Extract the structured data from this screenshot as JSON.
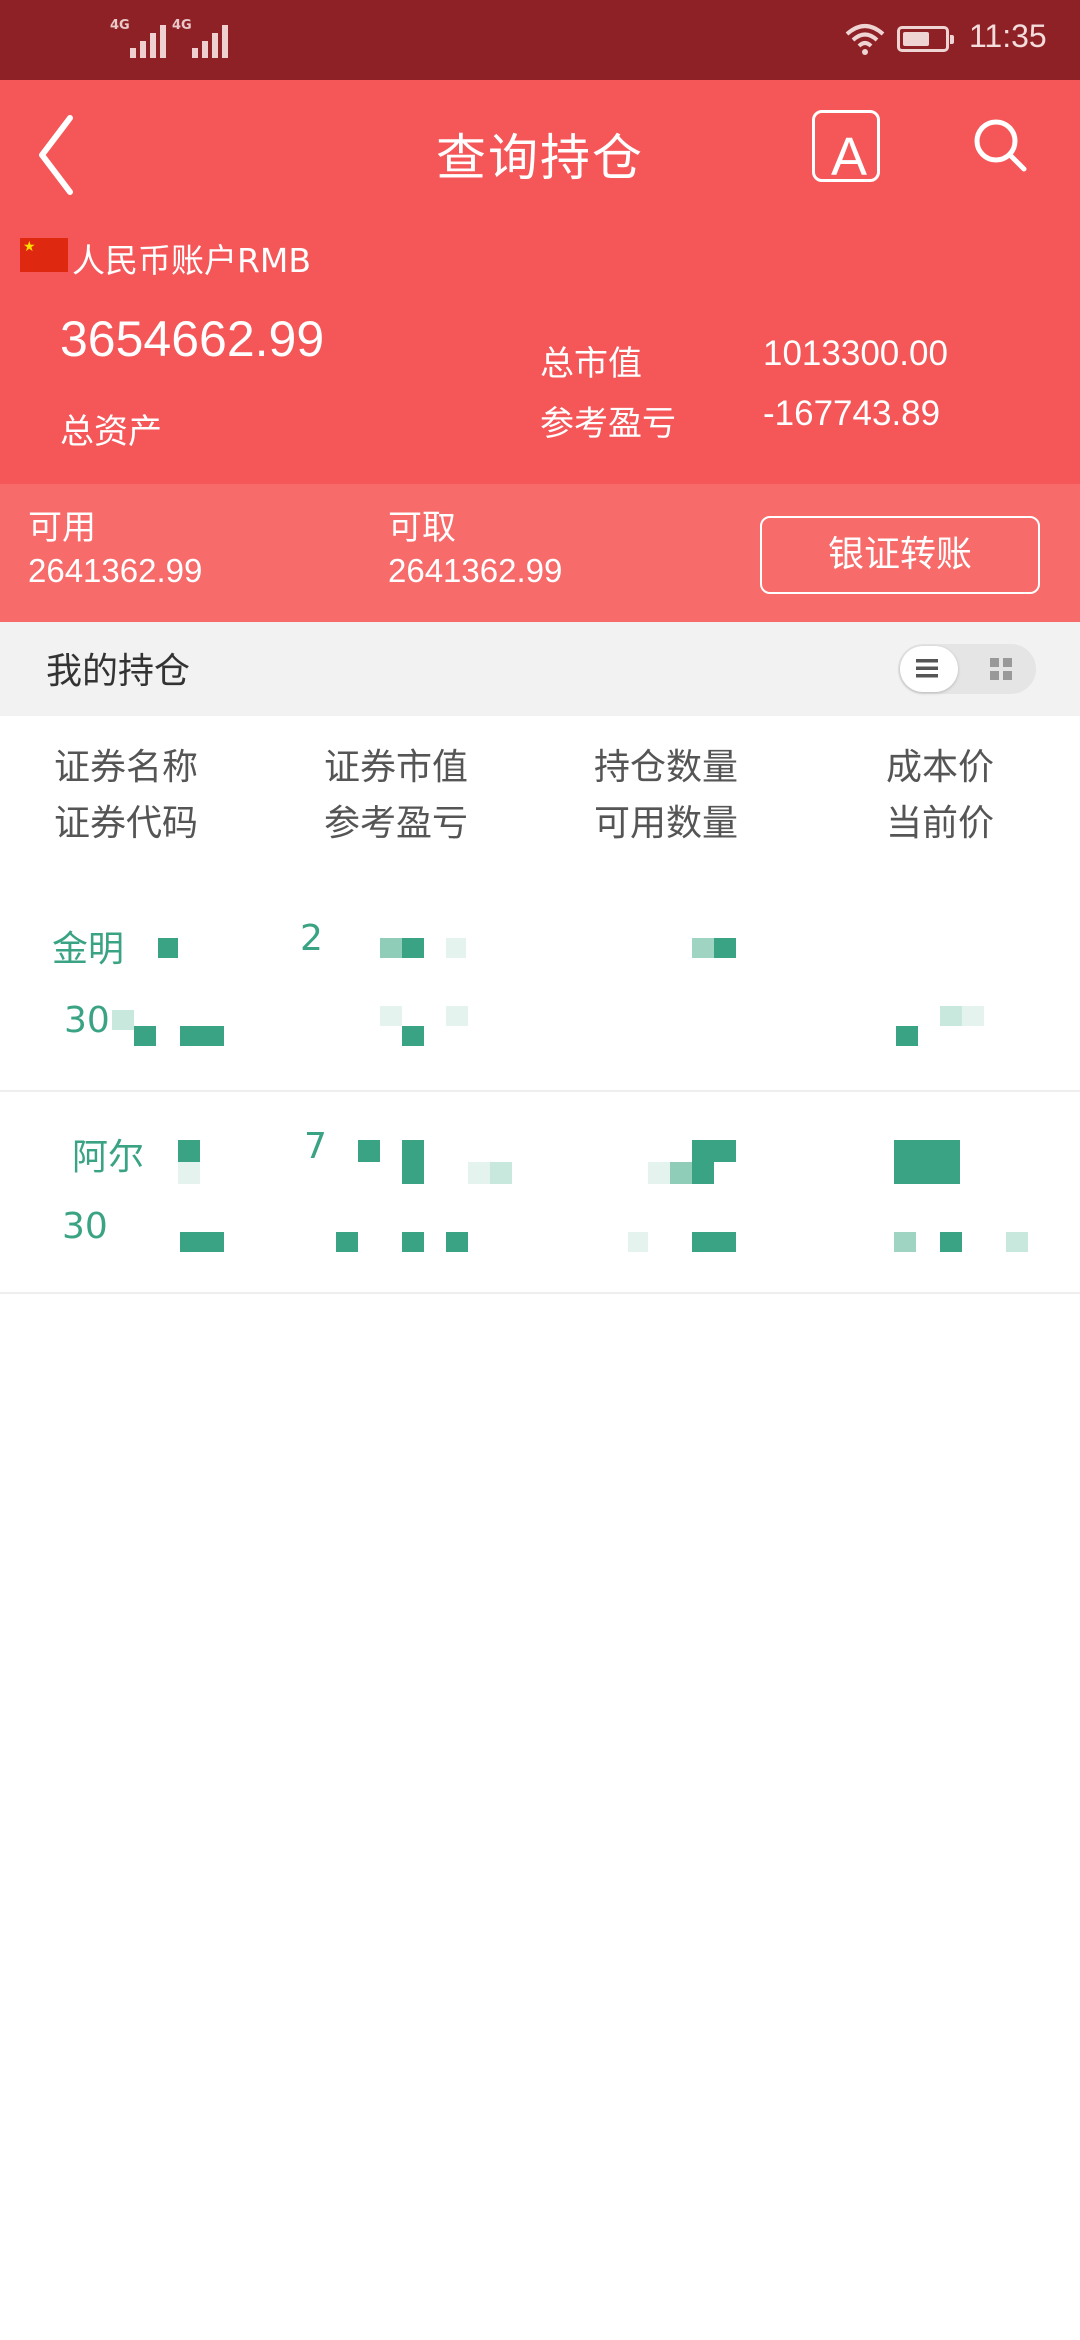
{
  "status_bar": {
    "signal_1_label": "4G",
    "signal_2_label": "4G",
    "time": "11:35",
    "battery_level": 0.65,
    "wifi_icon": "wifi-icon"
  },
  "header": {
    "title": "查询持仓",
    "font_button_label": "A",
    "back_icon": "back-chevron-icon",
    "search_icon": "search-icon"
  },
  "account": {
    "label": "人民币账户RMB",
    "flag_icon": "china-flag-icon",
    "total_assets_value": "3654662.99",
    "total_assets_label": "总资产",
    "market_value_label": "总市值",
    "market_value": "1013300.00",
    "pl_label": "参考盈亏",
    "pl_value": "-167743.89"
  },
  "funds": {
    "available_label": "可用",
    "available_value": "2641362.99",
    "withdrawable_label": "可取",
    "withdrawable_value": "2641362.99",
    "transfer_button": "银证转账"
  },
  "holdings": {
    "section_title": "我的持仓",
    "view_toggle": [
      "list-view-icon",
      "grid-view-icon"
    ],
    "columns": [
      {
        "line1": "证券名称",
        "line2": "证券代码"
      },
      {
        "line1": "证券市值",
        "line2": "参考盈亏"
      },
      {
        "line1": "持仓数量",
        "line2": "可用数量"
      },
      {
        "line1": "成本价",
        "line2": "当前价"
      }
    ],
    "rows": [
      {
        "name": "金明",
        "code": "30",
        "market_value": "2"
      },
      {
        "name": "阿尔",
        "code": "30",
        "market_value": "7"
      }
    ]
  },
  "colors": {
    "status_bar": "#8e2125",
    "header": "#f55658",
    "subpanel": "#f76b6b",
    "holding_text": "#3aa383"
  }
}
